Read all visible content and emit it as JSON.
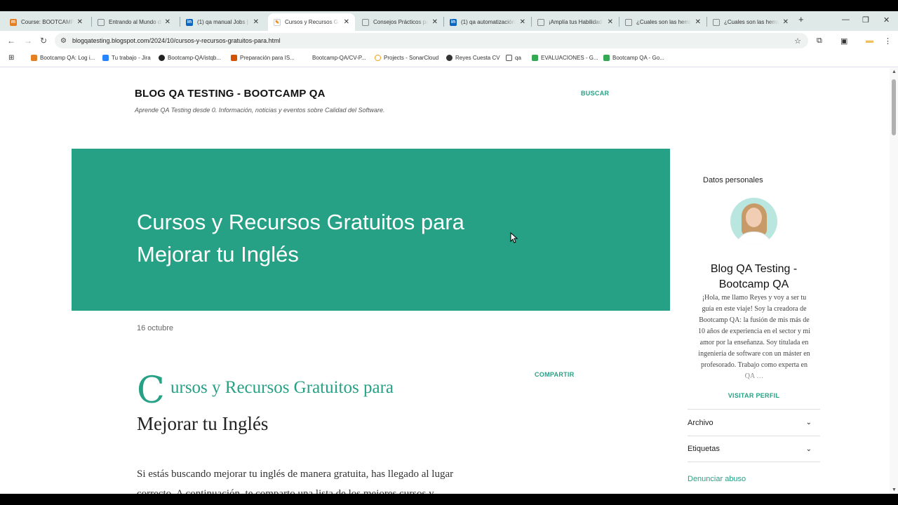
{
  "tabs": [
    {
      "title": "Course: BOOTCAMP Q",
      "color": "#e67e22",
      "icon": "moodle-icon"
    },
    {
      "title": "Entrando al Mundo de",
      "color": "#888888",
      "icon": "page-icon"
    },
    {
      "title": "(1) qa manual Jobs | L",
      "color": "#0a66c2",
      "icon": "linkedin-icon"
    },
    {
      "title": "Cursos y Recursos Gra",
      "color": "#f57c00",
      "icon": "blogger-icon",
      "active": true
    },
    {
      "title": "Consejos Prácticos pa",
      "color": "#888888",
      "icon": "page-icon"
    },
    {
      "title": "(1) qa automatización",
      "color": "#0a66c2",
      "icon": "linkedin-icon"
    },
    {
      "title": "¡Amplía tus Habilidad",
      "color": "#888888",
      "icon": "page-icon"
    },
    {
      "title": "¿Cuales son las herra",
      "color": "#888888",
      "icon": "page-icon"
    },
    {
      "title": "¿Cuales son las herra",
      "color": "#888888",
      "icon": "page-icon"
    }
  ],
  "toolbar": {
    "url": "blogqatesting.blogspot.com/2024/10/cursos-y-recursos-gratuitos-para.html"
  },
  "bookmarks": [
    {
      "label": "Bootcamp QA: Log i...",
      "color": "#e67e22"
    },
    {
      "label": "Tu trabajo - Jira",
      "color": "#2684ff"
    },
    {
      "label": "Bootcamp-QA/istqb...",
      "color": "#222222"
    },
    {
      "label": "Preparación para IS...",
      "color": "#d35400"
    },
    {
      "label": "Bootcamp-QA/CV-P...",
      "color": "#ffffff"
    },
    {
      "label": "Projects - SonarCloud",
      "color": "#f39c12"
    },
    {
      "label": "Reyes Cuesta CV",
      "color": "#333333"
    },
    {
      "label": "qa",
      "color": "#ffffff"
    },
    {
      "label": "EVALUACIONES - G...",
      "color": "#34a853"
    },
    {
      "label": "Bootcamp QA - Go...",
      "color": "#34a853"
    }
  ],
  "blog": {
    "title": "BLOG QA TESTING - BOOTCAMP QA",
    "description": "Aprende QA Testing desde 0. Información, noticias y eventos sobre Calidad del Software.",
    "search": "BUSCAR"
  },
  "post": {
    "hero_title": "Cursos y Recursos Gratuitos para Mejorar tu Inglés",
    "date": "16 octubre",
    "share": "COMPARTIR",
    "drop_cap": "C",
    "heading_line1": "ursos y Recursos Gratuitos para",
    "heading_line2": "Mejorar tu Inglés",
    "body": "Si estás buscando mejorar tu inglés de manera gratuita, has llegado al lugar correcto. A continuación, te comparto una lista de los mejores cursos y"
  },
  "sidebar": {
    "section_label": "Datos personales",
    "profile_name": "Blog QA Testing - Bootcamp QA",
    "bio": "¡Hola, me llamo Reyes y voy a ser tu guía en este viaje! Soy la creadora de Bootcamp QA: la fusión de mis más de 10 años de experiencia en el sector y mi amor por la enseñanza. Soy titulada en ingeniería de software con un máster en profesorado. Trabajo como experta en QA …",
    "visit_profile": "VISITAR PERFIL",
    "archive": "Archivo",
    "labels": "Etiquetas",
    "report_abuse": "Denunciar abuso"
  },
  "colors": {
    "accent": "#26a185"
  }
}
